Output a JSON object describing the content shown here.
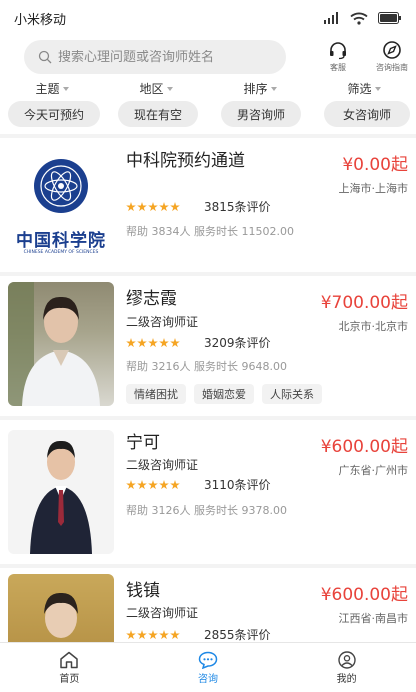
{
  "status_bar": {
    "carrier": "小米移动"
  },
  "search": {
    "placeholder": "搜索心理问题或咨询师姓名"
  },
  "top_actions": [
    {
      "label": "客服",
      "icon": "headset-icon"
    },
    {
      "label": "咨询指南",
      "icon": "compass-icon"
    }
  ],
  "filters": [
    "主题",
    "地区",
    "排序",
    "筛选"
  ],
  "quick_filters": [
    "今天可预约",
    "现在有空",
    "男咨询师",
    "女咨询师"
  ],
  "counselors": [
    {
      "name": "中科院预约通道",
      "price": "¥0.00起",
      "location": "上海市·上海市",
      "title": "",
      "reviews": "3815条评价",
      "stats": "帮助 3834人 服务时长 11502.00",
      "tags": [],
      "logo_text": "中国科学院",
      "logo_subtext": "CHINESE ACADEMY OF SCIENCES"
    },
    {
      "name": "缪志霞",
      "price": "¥700.00起",
      "location": "北京市·北京市",
      "title": "二级咨询师证",
      "reviews": "3209条评价",
      "stats": "帮助 3216人 服务时长 9648.00",
      "tags": [
        "情绪困扰",
        "婚姻恋爱",
        "人际关系"
      ]
    },
    {
      "name": "宁可",
      "price": "¥600.00起",
      "location": "广东省·广州市",
      "title": "二级咨询师证",
      "reviews": "3110条评价",
      "stats": "帮助 3126人 服务时长 9378.00",
      "tags": []
    },
    {
      "name": "钱镇",
      "price": "¥600.00起",
      "location": "江西省·南昌市",
      "title": "二级咨询师证",
      "reviews": "2855条评价",
      "stats": "",
      "tags": []
    }
  ],
  "rating_stars": 5,
  "bottom_nav": [
    {
      "label": "首页",
      "icon": "home-icon",
      "active": false
    },
    {
      "label": "咨询",
      "icon": "chat-icon",
      "active": true
    },
    {
      "label": "我的",
      "icon": "user-icon",
      "active": false
    }
  ],
  "colors": {
    "price": "#e8433b",
    "star": "#f5a524",
    "active_nav": "#1e88e5"
  }
}
